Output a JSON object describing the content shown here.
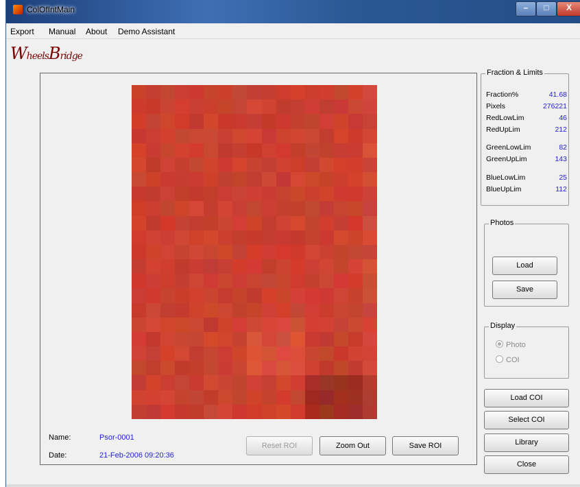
{
  "window": {
    "title": "ColOfIntMain"
  },
  "window_controls": {
    "minimize": "–",
    "maximize": "□",
    "close": "X"
  },
  "menu": [
    "Export",
    "Manual",
    "About",
    "Demo Assistant"
  ],
  "logo": {
    "part1_initial": "W",
    "part1_rest": "heels",
    "part2_initial": "B",
    "part2_rest": "ridge"
  },
  "image_info": {
    "name_label": "Name:",
    "name_value": "Psor-0001",
    "date_label": "Date:",
    "date_value": "21-Feb-2006 09:20:36"
  },
  "axes_buttons": {
    "reset_roi": "Reset ROI",
    "zoom_out": "Zoom Out",
    "save_roi": "Save ROI"
  },
  "fraction_limits": {
    "title": "Fraction & Limits",
    "rows": [
      {
        "label": "Fraction%",
        "value": "41.68"
      },
      {
        "label": "Pixels",
        "value": "276221"
      },
      {
        "label": "RedLowLim",
        "value": "46"
      },
      {
        "label": "RedUpLim",
        "value": "212"
      },
      {
        "label": "GreenLowLim",
        "value": "82"
      },
      {
        "label": "GreenUpLim",
        "value": "143"
      },
      {
        "label": "BlueLowLim",
        "value": "25"
      },
      {
        "label": "BlueUpLim",
        "value": "112"
      }
    ]
  },
  "photos": {
    "title": "Photos",
    "load": "Load",
    "save": "Save"
  },
  "display": {
    "title": "Display",
    "options": [
      "Photo",
      "COI"
    ],
    "selected": "Photo"
  },
  "side_buttons": {
    "load_coi": "Load COI",
    "select_coi": "Select COI",
    "library": "Library",
    "close": "Close"
  },
  "colors": {
    "accent_value": "#1f1fcf",
    "image_base": "#c9442f",
    "logo": "#7a0000"
  }
}
